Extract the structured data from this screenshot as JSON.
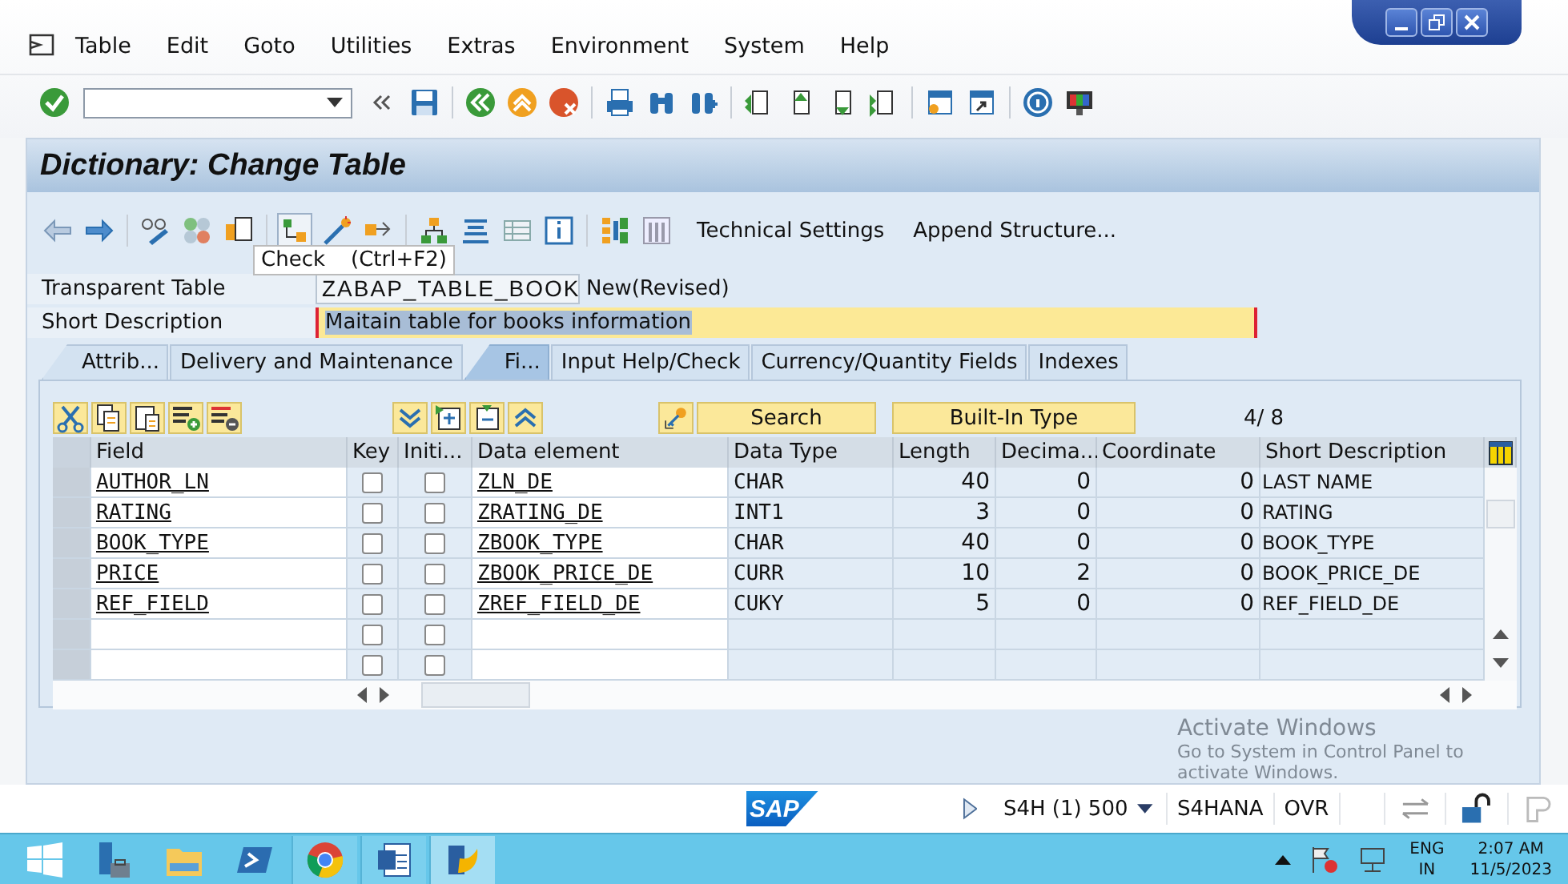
{
  "menu_bar": {
    "items": [
      "Table",
      "Edit",
      "Goto",
      "Utilities",
      "Extras",
      "Environment",
      "System",
      "Help"
    ]
  },
  "title": "Dictionary: Change Table",
  "app_toolbar": {
    "buttons": [
      "Technical Settings",
      "Append Structure..."
    ]
  },
  "tooltip": {
    "text": "Check",
    "shortcut": "(Ctrl+F2)"
  },
  "table_name": {
    "label": "Transparent Table",
    "value": "ZABAP_TABLE_BOOK",
    "status": "New(Revised)"
  },
  "short_description": {
    "label": "Short Description",
    "value": "Maitain table for books information",
    "required": true,
    "text_selected": true
  },
  "tabs": [
    {
      "label": "Attrib...",
      "selected": false
    },
    {
      "label": "Delivery and Maintenance",
      "selected": false
    },
    {
      "label": "Fi...",
      "selected": true
    },
    {
      "label": "Input Help/Check",
      "selected": false
    },
    {
      "label": "Currency/Quantity Fields",
      "selected": false
    },
    {
      "label": "Indexes",
      "selected": false
    }
  ],
  "fields_toolbar": {
    "search": "Search",
    "type_button": "Built-In Type",
    "counter": "4/ 8"
  },
  "table": {
    "columns": [
      "Field",
      "Key",
      "Initi...",
      "Data element",
      "Data Type",
      "Length",
      "Decima...",
      "Coordinate",
      "Short Description"
    ],
    "rows": [
      {
        "field": "AUTHOR_LN",
        "key": false,
        "initial": false,
        "data_element": "ZLN_DE",
        "data_type": "CHAR",
        "length": "40",
        "decimals": "0",
        "coordinate": "0",
        "short_description": "LAST NAME"
      },
      {
        "field": "RATING",
        "key": false,
        "initial": false,
        "data_element": "ZRATING_DE",
        "data_type": "INT1",
        "length": "3",
        "decimals": "0",
        "coordinate": "0",
        "short_description": "RATING"
      },
      {
        "field": "BOOK_TYPE",
        "key": false,
        "initial": false,
        "data_element": "ZBOOK_TYPE",
        "data_type": "CHAR",
        "length": "40",
        "decimals": "0",
        "coordinate": "0",
        "short_description": "BOOK_TYPE"
      },
      {
        "field": "PRICE",
        "key": false,
        "initial": false,
        "data_element": "ZBOOK_PRICE_DE",
        "data_type": "CURR",
        "length": "10",
        "decimals": "2",
        "coordinate": "0",
        "short_description": "BOOK_PRICE_DE"
      },
      {
        "field": "REF_FIELD",
        "key": false,
        "initial": false,
        "data_element": "ZREF_FIELD_DE",
        "data_type": "CUKY",
        "length": "5",
        "decimals": "0",
        "coordinate": "0",
        "short_description": "REF_FIELD_DE"
      }
    ],
    "empty_rows": [
      {
        "key": false,
        "initial": false
      },
      {
        "key": false,
        "initial": false
      }
    ]
  },
  "activation_notice": {
    "title": "Activate Windows",
    "text": "Go to System in Control Panel to activate Windows."
  },
  "status_bar": {
    "logo": "SAP",
    "system": "S4H (1) 500",
    "server": "S4HANA",
    "mode": "OVR"
  },
  "taskbar": {
    "language": "ENG",
    "region": "IN",
    "time": "2:07 AM",
    "date": "11/5/2023"
  }
}
